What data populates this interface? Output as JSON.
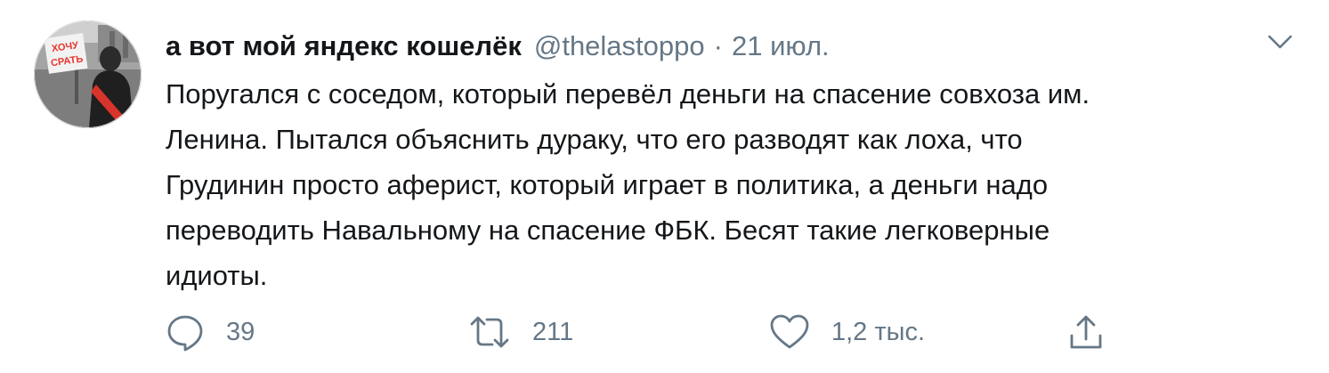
{
  "tweet": {
    "display_name": "а вот мой яндекс кошелёк",
    "handle": "@thelastoppo",
    "separator": "·",
    "date": "21 июл.",
    "avatar_sign": {
      "line1": "ХОЧУ",
      "line2": "СРАТЬ"
    },
    "text_lines": [
      "Поругался с соседом, который перевёл деньги на спасение совхоза им.",
      "Ленина. Пытался объяснить дураку, что его разводят как лоха, что",
      "Грудинин просто аферист, который играет в политика, а деньги надо",
      "переводить Навальному на спасение ФБК. Бесят такие легковерные",
      "идиоты."
    ],
    "actions": {
      "reply_count": "39",
      "retweet_count": "211",
      "like_count": "1,2 тыс."
    },
    "icons": {
      "caret": "chevron-down-icon",
      "reply": "reply-icon",
      "retweet": "retweet-icon",
      "like": "heart-icon",
      "share": "share-icon"
    },
    "colors": {
      "text": "#14171a",
      "secondary": "#657786",
      "icon": "#657786",
      "avatar_sign": "#e8322a"
    }
  }
}
